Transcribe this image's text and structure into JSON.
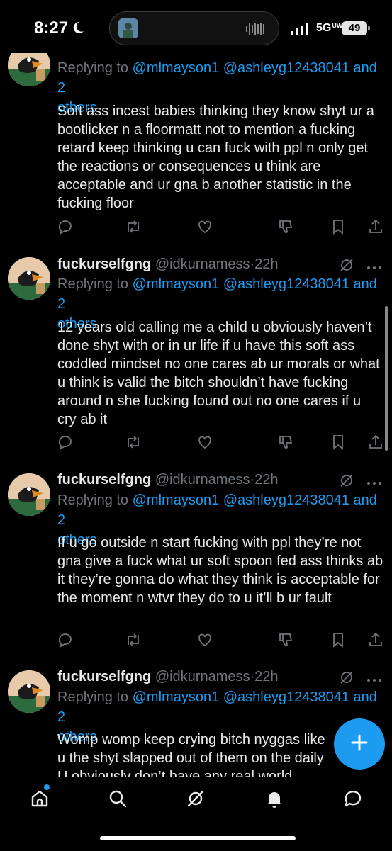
{
  "status_bar": {
    "time": "8:27",
    "network": "5G",
    "network_sup": "UW",
    "battery": "49"
  },
  "reply_prefix": "Replying to",
  "tweets": [
    {
      "username": "",
      "handle": "",
      "time": "",
      "reply_mentions": "@mlmayson1 @ashleyg12438041 and 2",
      "reply_others": "others",
      "text": "Soft ass incest babies thinking they know shyt ur a bootlicker n a floormatt not to mention a fucking retard keep thinking u can fuck with ppl n only get the reactions or consequences u think are acceptable and ur gna b another statistic in the fucking floor"
    },
    {
      "username": "fuckurselfgng",
      "handle": "@idkurnamess",
      "time": "22h",
      "reply_mentions": "@mlmayson1 @ashleyg12438041 and 2",
      "reply_others": "others",
      "text": "12 years old calling me a child u obviously haven’t done shyt with or in ur life if u have this soft ass coddled mindset no one cares ab ur morals or what u think is valid the bitch shouldn’t have fucking around n she fucking found out no one cares if u cry ab it"
    },
    {
      "username": "fuckurselfgng",
      "handle": "@idkurnamess",
      "time": "22h",
      "reply_mentions": "@mlmayson1 @ashleyg12438041 and 2",
      "reply_others": "others",
      "text": "If u go outside n start fucking with ppl they’re not gna give a fuck what ur soft spoon fed ass thinks ab it they’re gonna do what they think is acceptable for the moment n wtvr they do to u it’ll b ur fault"
    },
    {
      "username": "fuckurselfgng",
      "handle": "@idkurnamess",
      "time": "22h",
      "reply_mentions": "@mlmayson1 @ashleyg12438041 and 2",
      "reply_others": "others",
      "text": "Womp womp keep crying bitch nyggas like u the shyt slapped out of them on the daily U obviously don’t have any real world experience if u"
    }
  ],
  "icons": {
    "actions": [
      "reply-icon",
      "retweet-icon",
      "like-icon",
      "downvote-icon",
      "bookmark-icon",
      "share-icon"
    ],
    "nav": [
      "home-icon",
      "search-icon",
      "grok-icon",
      "notifications-icon",
      "messages-icon"
    ],
    "fab": "compose-plus-icon"
  },
  "colors": {
    "accent": "#1d9bf0",
    "text": "#e7e9ea",
    "muted": "#71767b",
    "background": "#000000"
  }
}
